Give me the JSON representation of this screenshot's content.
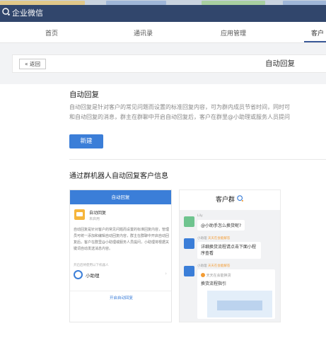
{
  "app": {
    "brand": "企业微信"
  },
  "nav": {
    "tabs": [
      "首页",
      "通讯录",
      "应用管理",
      "客户"
    ]
  },
  "subheader": {
    "back": "« 返回",
    "title": "自动回复"
  },
  "intro": {
    "title": "自动回复",
    "line1": "自动回复是针对客户的常见问题而设置的标准回复内容，可为群内成员节省时间，同时可",
    "line2": "和自动回复的消息，群主在群聊中开启自动回复后，客户在群里@小助理或服务人员提问",
    "new_button": "新建"
  },
  "section2": {
    "title": "通过群机器人自动回复客户信息"
  },
  "left_card": {
    "header": "自动回复",
    "msg_title": "自动回复",
    "msg_sub": "未启用",
    "body": "自动回复是针对客户的常见问题而设置的标准回复内容，管理员可统一添加和编辑自动回复内容，群主在群聊中开启自动回复后，客户在群里@小助理或服务人员提问，小助理将根据关键词自动发送消息内容。",
    "small": "开启后将使用以下机器人",
    "helper": "小助理",
    "helper_tag": "",
    "link": "开启自动回复"
  },
  "right_card": {
    "header": "客户群",
    "m1_name": "Lily",
    "m1_text": "@小助手怎么换货呢?",
    "m2_name": "小助理",
    "m2_tag": "天天在会能解答",
    "m2_text": "详细换货流程请点击下面小程序查看",
    "m3_name": "小助理",
    "m3_tag": "天天在会能解答",
    "m3_app": "天天在会能换货",
    "m3_title": "换货流程指引"
  },
  "colors": {
    "appbar": "#31466c",
    "accent": "#3b7ed8",
    "tag": "#f39c34"
  }
}
